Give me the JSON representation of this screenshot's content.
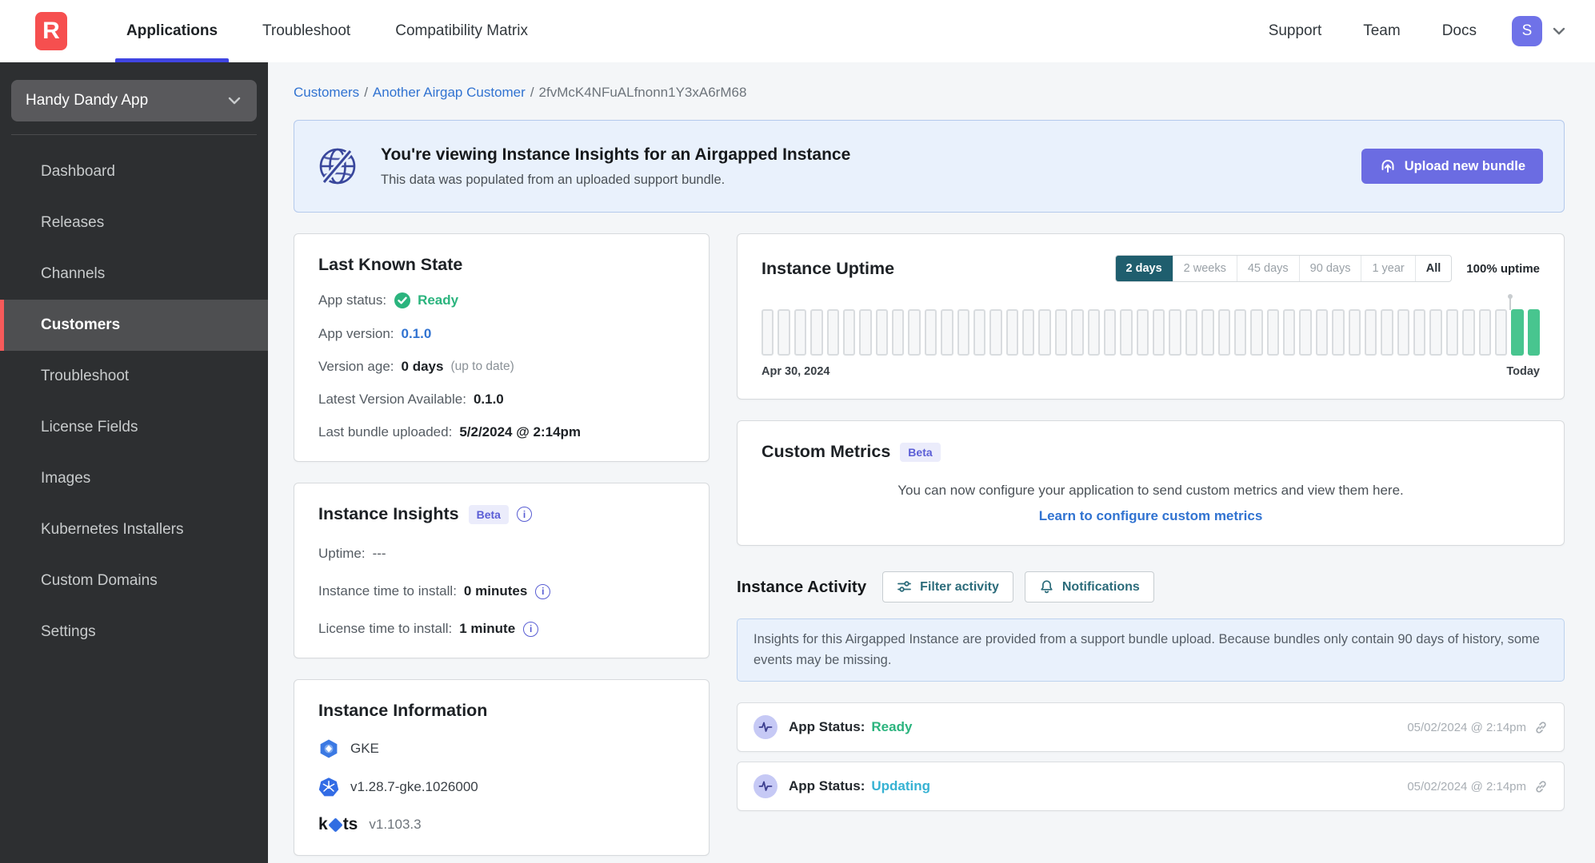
{
  "topnav": {
    "logo_letter": "R",
    "items": [
      {
        "label": "Applications",
        "active": true
      },
      {
        "label": "Troubleshoot",
        "active": false
      },
      {
        "label": "Compatibility Matrix",
        "active": false
      }
    ],
    "right_items": [
      "Support",
      "Team",
      "Docs"
    ],
    "avatar_initial": "S"
  },
  "sidebar": {
    "app_selector_label": "Handy Dandy App",
    "items": [
      {
        "label": "Dashboard",
        "active": false
      },
      {
        "label": "Releases",
        "active": false
      },
      {
        "label": "Channels",
        "active": false
      },
      {
        "label": "Customers",
        "active": true
      },
      {
        "label": "Troubleshoot",
        "active": false
      },
      {
        "label": "License Fields",
        "active": false
      },
      {
        "label": "Images",
        "active": false
      },
      {
        "label": "Kubernetes Installers",
        "active": false
      },
      {
        "label": "Custom Domains",
        "active": false
      },
      {
        "label": "Settings",
        "active": false
      }
    ]
  },
  "breadcrumb": [
    {
      "label": "Customers",
      "link": true
    },
    {
      "label": "Another Airgap Customer",
      "link": true
    },
    {
      "label": "2fvMcK4NFuALfnonn1Y3xA6rM68",
      "link": false
    }
  ],
  "banner": {
    "title": "You're viewing Instance Insights for an Airgapped Instance",
    "subtitle": "This data was populated from an uploaded support bundle.",
    "button_label": "Upload new bundle"
  },
  "last_known_state": {
    "title": "Last Known State",
    "rows": [
      {
        "label": "App status:",
        "value": "Ready",
        "type": "status"
      },
      {
        "label": "App version:",
        "value": "0.1.0",
        "type": "link"
      },
      {
        "label": "Version age:",
        "value": "0 days",
        "suffix": "(up to date)",
        "type": "bold"
      },
      {
        "label": "Latest Version Available:",
        "value": "0.1.0",
        "type": "bold"
      },
      {
        "label": "Last bundle uploaded:",
        "value": "5/2/2024 @ 2:14pm",
        "type": "bold"
      }
    ]
  },
  "instance_insights": {
    "title": "Instance Insights",
    "beta_label": "Beta",
    "rows": [
      {
        "label": "Uptime:",
        "value": "---",
        "bold": false,
        "info": false
      },
      {
        "label": "Instance time to install:",
        "value": "0 minutes",
        "bold": true,
        "info": true
      },
      {
        "label": "License time to install:",
        "value": "1 minute",
        "bold": true,
        "info": true
      }
    ]
  },
  "instance_information": {
    "title": "Instance Information",
    "rows": [
      {
        "icon": "gke-icon",
        "brand": "",
        "value": "GKE"
      },
      {
        "icon": "kubernetes-icon",
        "brand": "",
        "value": "v1.28.7-gke.1026000"
      },
      {
        "icon": "kots-logo",
        "brand": "kots",
        "value": "v1.103.3"
      }
    ]
  },
  "instance_uptime": {
    "title": "Instance Uptime",
    "ranges": [
      {
        "label": "2 days",
        "active": true,
        "all": false
      },
      {
        "label": "2 weeks",
        "active": false,
        "all": false
      },
      {
        "label": "45 days",
        "active": false,
        "all": false
      },
      {
        "label": "90 days",
        "active": false,
        "all": false
      },
      {
        "label": "1 year",
        "active": false,
        "all": false
      },
      {
        "label": "All",
        "active": false,
        "all": true
      }
    ],
    "uptime_text": "100% uptime"
  },
  "chart_data": {
    "type": "bar",
    "title": "Instance Uptime",
    "selected_range": "2 days",
    "range_options": [
      "2 days",
      "2 weeks",
      "45 days",
      "90 days",
      "1 year",
      "All"
    ],
    "summary": "100% uptime",
    "x_start_label": "Apr 30, 2024",
    "x_end_label": "Today",
    "bar_count": 48,
    "legend_note": "empty bars = no data; green bars = 100% uptime",
    "values": [
      "no-data",
      "no-data",
      "no-data",
      "no-data",
      "no-data",
      "no-data",
      "no-data",
      "no-data",
      "no-data",
      "no-data",
      "no-data",
      "no-data",
      "no-data",
      "no-data",
      "no-data",
      "no-data",
      "no-data",
      "no-data",
      "no-data",
      "no-data",
      "no-data",
      "no-data",
      "no-data",
      "no-data",
      "no-data",
      "no-data",
      "no-data",
      "no-data",
      "no-data",
      "no-data",
      "no-data",
      "no-data",
      "no-data",
      "no-data",
      "no-data",
      "no-data",
      "no-data",
      "no-data",
      "no-data",
      "no-data",
      "no-data",
      "no-data",
      "no-data",
      "no-data",
      "no-data",
      "no-data",
      "up",
      "up"
    ]
  },
  "custom_metrics": {
    "title": "Custom Metrics",
    "beta_label": "Beta",
    "body": "You can now configure your application to send custom metrics and view them here.",
    "link_label": "Learn to configure custom metrics"
  },
  "instance_activity": {
    "title": "Instance Activity",
    "filter_button_label": "Filter activity",
    "notifications_button_label": "Notifications",
    "notice": "Insights for this Airgapped Instance are provided from a support bundle upload. Because bundles only contain 90 days of history, some events may be missing.",
    "events": [
      {
        "label": "App Status:",
        "value": "Ready",
        "color": "#2bb47e",
        "timestamp": "05/02/2024 @ 2:14pm"
      },
      {
        "label": "App Status:",
        "value": "Updating",
        "color": "#36b2d3",
        "timestamp": "05/02/2024 @ 2:14pm"
      }
    ]
  },
  "colors": {
    "accent_indigo": "#6b6ce2",
    "accent_blue_link": "#3173d1",
    "status_ready_green": "#2bb47e",
    "status_updating_cyan": "#36b2d3",
    "uptime_bar_green": "#48c58f",
    "active_segment_teal": "#1f5e6e",
    "sidebar_active_red": "#f75a5a"
  }
}
